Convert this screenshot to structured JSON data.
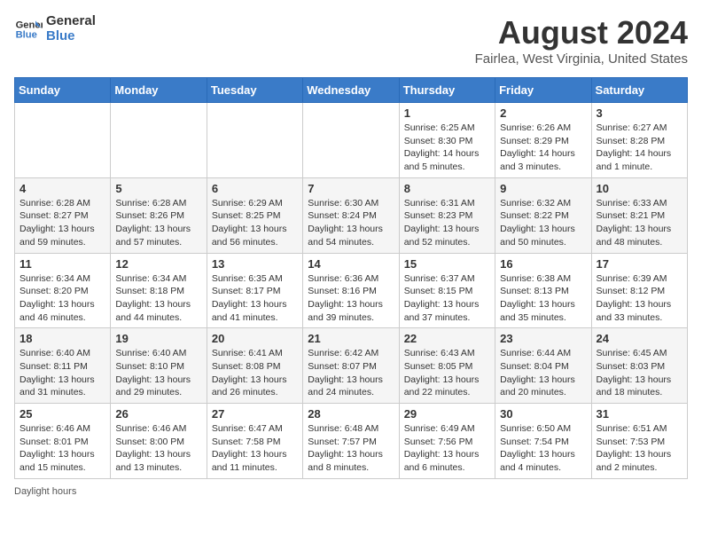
{
  "header": {
    "logo_line1": "General",
    "logo_line2": "Blue",
    "main_title": "August 2024",
    "subtitle": "Fairlea, West Virginia, United States"
  },
  "days_of_week": [
    "Sunday",
    "Monday",
    "Tuesday",
    "Wednesday",
    "Thursday",
    "Friday",
    "Saturday"
  ],
  "weeks": [
    [
      {
        "day": "",
        "info": ""
      },
      {
        "day": "",
        "info": ""
      },
      {
        "day": "",
        "info": ""
      },
      {
        "day": "",
        "info": ""
      },
      {
        "day": "1",
        "info": "Sunrise: 6:25 AM\nSunset: 8:30 PM\nDaylight: 14 hours\nand 5 minutes."
      },
      {
        "day": "2",
        "info": "Sunrise: 6:26 AM\nSunset: 8:29 PM\nDaylight: 14 hours\nand 3 minutes."
      },
      {
        "day": "3",
        "info": "Sunrise: 6:27 AM\nSunset: 8:28 PM\nDaylight: 14 hours\nand 1 minute."
      }
    ],
    [
      {
        "day": "4",
        "info": "Sunrise: 6:28 AM\nSunset: 8:27 PM\nDaylight: 13 hours\nand 59 minutes."
      },
      {
        "day": "5",
        "info": "Sunrise: 6:28 AM\nSunset: 8:26 PM\nDaylight: 13 hours\nand 57 minutes."
      },
      {
        "day": "6",
        "info": "Sunrise: 6:29 AM\nSunset: 8:25 PM\nDaylight: 13 hours\nand 56 minutes."
      },
      {
        "day": "7",
        "info": "Sunrise: 6:30 AM\nSunset: 8:24 PM\nDaylight: 13 hours\nand 54 minutes."
      },
      {
        "day": "8",
        "info": "Sunrise: 6:31 AM\nSunset: 8:23 PM\nDaylight: 13 hours\nand 52 minutes."
      },
      {
        "day": "9",
        "info": "Sunrise: 6:32 AM\nSunset: 8:22 PM\nDaylight: 13 hours\nand 50 minutes."
      },
      {
        "day": "10",
        "info": "Sunrise: 6:33 AM\nSunset: 8:21 PM\nDaylight: 13 hours\nand 48 minutes."
      }
    ],
    [
      {
        "day": "11",
        "info": "Sunrise: 6:34 AM\nSunset: 8:20 PM\nDaylight: 13 hours\nand 46 minutes."
      },
      {
        "day": "12",
        "info": "Sunrise: 6:34 AM\nSunset: 8:18 PM\nDaylight: 13 hours\nand 44 minutes."
      },
      {
        "day": "13",
        "info": "Sunrise: 6:35 AM\nSunset: 8:17 PM\nDaylight: 13 hours\nand 41 minutes."
      },
      {
        "day": "14",
        "info": "Sunrise: 6:36 AM\nSunset: 8:16 PM\nDaylight: 13 hours\nand 39 minutes."
      },
      {
        "day": "15",
        "info": "Sunrise: 6:37 AM\nSunset: 8:15 PM\nDaylight: 13 hours\nand 37 minutes."
      },
      {
        "day": "16",
        "info": "Sunrise: 6:38 AM\nSunset: 8:13 PM\nDaylight: 13 hours\nand 35 minutes."
      },
      {
        "day": "17",
        "info": "Sunrise: 6:39 AM\nSunset: 8:12 PM\nDaylight: 13 hours\nand 33 minutes."
      }
    ],
    [
      {
        "day": "18",
        "info": "Sunrise: 6:40 AM\nSunset: 8:11 PM\nDaylight: 13 hours\nand 31 minutes."
      },
      {
        "day": "19",
        "info": "Sunrise: 6:40 AM\nSunset: 8:10 PM\nDaylight: 13 hours\nand 29 minutes."
      },
      {
        "day": "20",
        "info": "Sunrise: 6:41 AM\nSunset: 8:08 PM\nDaylight: 13 hours\nand 26 minutes."
      },
      {
        "day": "21",
        "info": "Sunrise: 6:42 AM\nSunset: 8:07 PM\nDaylight: 13 hours\nand 24 minutes."
      },
      {
        "day": "22",
        "info": "Sunrise: 6:43 AM\nSunset: 8:05 PM\nDaylight: 13 hours\nand 22 minutes."
      },
      {
        "day": "23",
        "info": "Sunrise: 6:44 AM\nSunset: 8:04 PM\nDaylight: 13 hours\nand 20 minutes."
      },
      {
        "day": "24",
        "info": "Sunrise: 6:45 AM\nSunset: 8:03 PM\nDaylight: 13 hours\nand 18 minutes."
      }
    ],
    [
      {
        "day": "25",
        "info": "Sunrise: 6:46 AM\nSunset: 8:01 PM\nDaylight: 13 hours\nand 15 minutes."
      },
      {
        "day": "26",
        "info": "Sunrise: 6:46 AM\nSunset: 8:00 PM\nDaylight: 13 hours\nand 13 minutes."
      },
      {
        "day": "27",
        "info": "Sunrise: 6:47 AM\nSunset: 7:58 PM\nDaylight: 13 hours\nand 11 minutes."
      },
      {
        "day": "28",
        "info": "Sunrise: 6:48 AM\nSunset: 7:57 PM\nDaylight: 13 hours\nand 8 minutes."
      },
      {
        "day": "29",
        "info": "Sunrise: 6:49 AM\nSunset: 7:56 PM\nDaylight: 13 hours\nand 6 minutes."
      },
      {
        "day": "30",
        "info": "Sunrise: 6:50 AM\nSunset: 7:54 PM\nDaylight: 13 hours\nand 4 minutes."
      },
      {
        "day": "31",
        "info": "Sunrise: 6:51 AM\nSunset: 7:53 PM\nDaylight: 13 hours\nand 2 minutes."
      }
    ]
  ],
  "footer": {
    "daylight_label": "Daylight hours"
  }
}
